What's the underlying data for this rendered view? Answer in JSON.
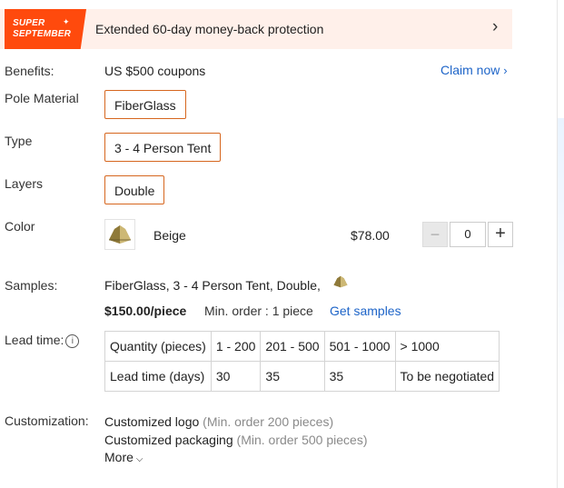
{
  "banner": {
    "badge_line1": "SUPER",
    "badge_line2": "SEPTEMBER",
    "text": "Extended 60-day money-back protection",
    "chevron_icon": "chevron-right-icon"
  },
  "benefits": {
    "label": "Benefits:",
    "value": "US $500 coupons",
    "link": "Claim now"
  },
  "pole_material": {
    "label": "Pole Material",
    "option": "FiberGlass"
  },
  "type": {
    "label": "Type",
    "option": "3 - 4 Person Tent"
  },
  "layers": {
    "label": "Layers",
    "option": "Double"
  },
  "color": {
    "label": "Color",
    "name": "Beige",
    "price": "$78.00",
    "quantity": "0",
    "minus": "−",
    "plus": "+"
  },
  "samples": {
    "label": "Samples:",
    "spec_1": "FiberGlass",
    "spec_2": "3 - 4 Person Tent",
    "spec_3": "Double",
    "price": "$150.00/piece",
    "min_order": "Min. order : 1 piece",
    "link": "Get samples"
  },
  "lead_time": {
    "label": "Lead time:",
    "table": {
      "row_header_qty": "Quantity (pieces)",
      "row_header_days": "Lead time (days)",
      "quantities": [
        "1 - 200",
        "201 - 500",
        "501 - 1000",
        "> 1000"
      ],
      "days": [
        "30",
        "35",
        "35",
        "To be negotiated"
      ]
    }
  },
  "customization": {
    "label": "Customization:",
    "item_1": "Customized logo",
    "item_1_note": "(Min. order 200 pieces)",
    "item_2": "Customized packaging",
    "item_2_note": "(Min. order 500 pieces)",
    "more": "More"
  },
  "colors": {
    "accent": "#ff4a0d",
    "option_border": "#d6661e",
    "link": "#1d64c8"
  }
}
